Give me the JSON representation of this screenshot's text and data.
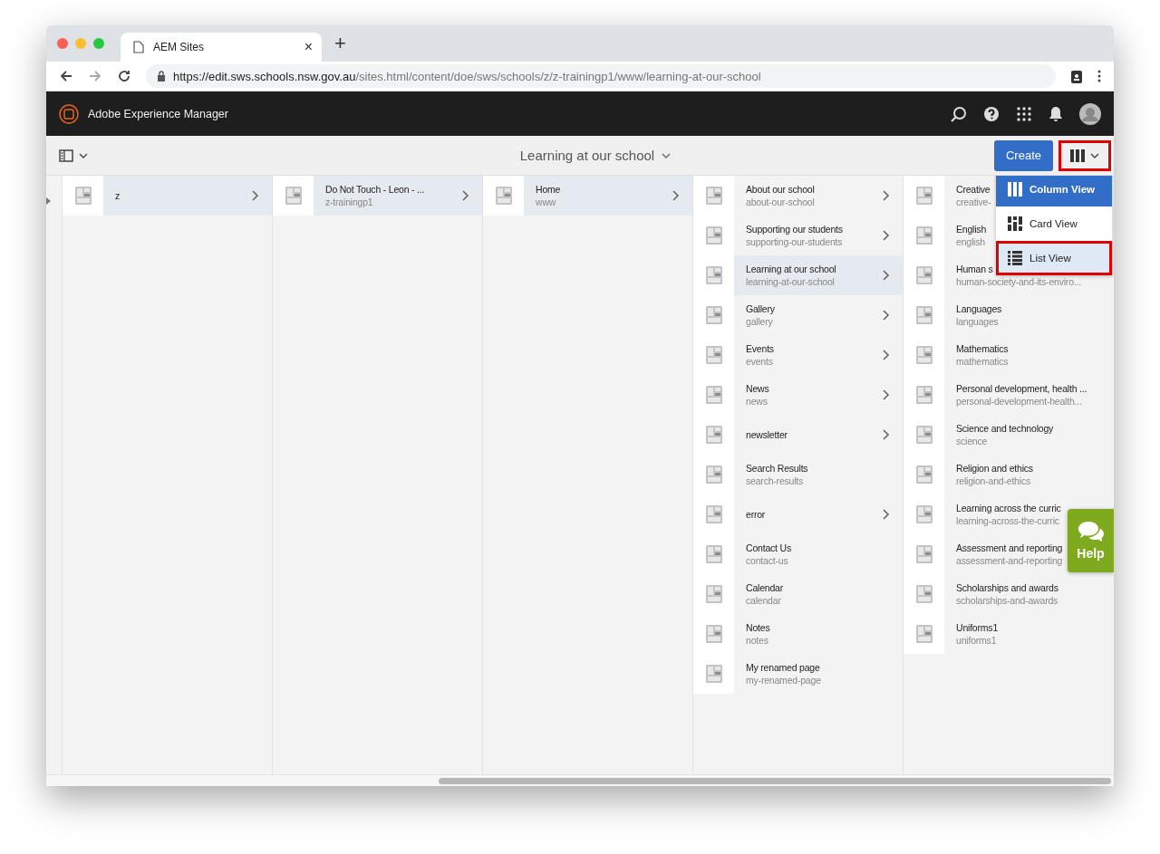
{
  "browser": {
    "tab_title": "AEM Sites",
    "tab_close": "×",
    "new_tab": "+",
    "url_host": "https://edit.sws.schools.nsw.gov.au",
    "url_path": "/sites.html/content/doe/sws/schools/z/z-trainingp1/www/learning-at-our-school"
  },
  "header": {
    "app_name": "Adobe Experience Manager"
  },
  "toolbar": {
    "title": "Learning at our school",
    "create_button": "Create",
    "view_button_annotated": true
  },
  "view_menu": [
    {
      "label": "Column View",
      "kind": "column",
      "selected": true,
      "annotated": false
    },
    {
      "label": "Card View",
      "kind": "card",
      "selected": false,
      "annotated": false
    },
    {
      "label": "List View",
      "kind": "list",
      "selected": false,
      "annotated": true
    }
  ],
  "columns": [
    {
      "items": [
        {
          "title": "z",
          "has_children": true,
          "selected": true
        }
      ]
    },
    {
      "items": [
        {
          "title": "Do Not Touch - Leon - ...",
          "name": "z-trainingp1",
          "has_children": true,
          "selected": true
        }
      ]
    },
    {
      "items": [
        {
          "title": "Home",
          "name": "www",
          "has_children": true,
          "selected": true
        }
      ]
    },
    {
      "items": [
        {
          "title": "About our school",
          "name": "about-our-school",
          "has_children": true,
          "selected": false
        },
        {
          "title": "Supporting our students",
          "name": "supporting-our-students",
          "has_children": true,
          "selected": false
        },
        {
          "title": "Learning at our school",
          "name": "learning-at-our-school",
          "has_children": true,
          "selected": true
        },
        {
          "title": "Gallery",
          "name": "gallery",
          "has_children": true,
          "selected": false
        },
        {
          "title": "Events",
          "name": "events",
          "has_children": true,
          "selected": false
        },
        {
          "title": "News",
          "name": "news",
          "has_children": true,
          "selected": false
        },
        {
          "title": "newsletter",
          "has_children": true,
          "selected": false
        },
        {
          "title": "Search Results",
          "name": "search-results",
          "has_children": false,
          "selected": false
        },
        {
          "title": "error",
          "has_children": true,
          "selected": false
        },
        {
          "title": "Contact Us",
          "name": "contact-us",
          "has_children": false,
          "selected": false
        },
        {
          "title": "Calendar",
          "name": "calendar",
          "has_children": false,
          "selected": false
        },
        {
          "title": "Notes",
          "name": "notes",
          "has_children": false,
          "selected": false
        },
        {
          "title": "My renamed page",
          "name": "my-renamed-page",
          "has_children": false,
          "selected": false
        }
      ]
    },
    {
      "items": [
        {
          "title": "Creative",
          "name": "creative-",
          "has_children": false,
          "selected": false
        },
        {
          "title": "English",
          "name": "english",
          "has_children": false,
          "selected": false
        },
        {
          "title": "Human s",
          "name": "human-society-and-its-enviro...",
          "has_children": false,
          "selected": false
        },
        {
          "title": "Languages",
          "name": "languages",
          "has_children": false,
          "selected": false
        },
        {
          "title": "Mathematics",
          "name": "mathematics",
          "has_children": false,
          "selected": false
        },
        {
          "title": "Personal development, health ...",
          "name": "personal-development-health...",
          "has_children": false,
          "selected": false
        },
        {
          "title": "Science and technology",
          "name": "science",
          "has_children": false,
          "selected": false
        },
        {
          "title": "Religion and ethics",
          "name": "religion-and-ethics",
          "has_children": false,
          "selected": false
        },
        {
          "title": "Learning across the curric",
          "name": "learning-across-the-curric",
          "has_children": false,
          "selected": false
        },
        {
          "title": "Assessment and reporting",
          "name": "assessment-and-reporting",
          "has_children": false,
          "selected": false
        },
        {
          "title": "Scholarships and awards",
          "name": "scholarships-and-awards",
          "has_children": false,
          "selected": false
        },
        {
          "title": "Uniforms1",
          "name": "uniforms1",
          "has_children": false,
          "selected": false
        }
      ]
    }
  ],
  "help_button": {
    "label": "Help"
  }
}
